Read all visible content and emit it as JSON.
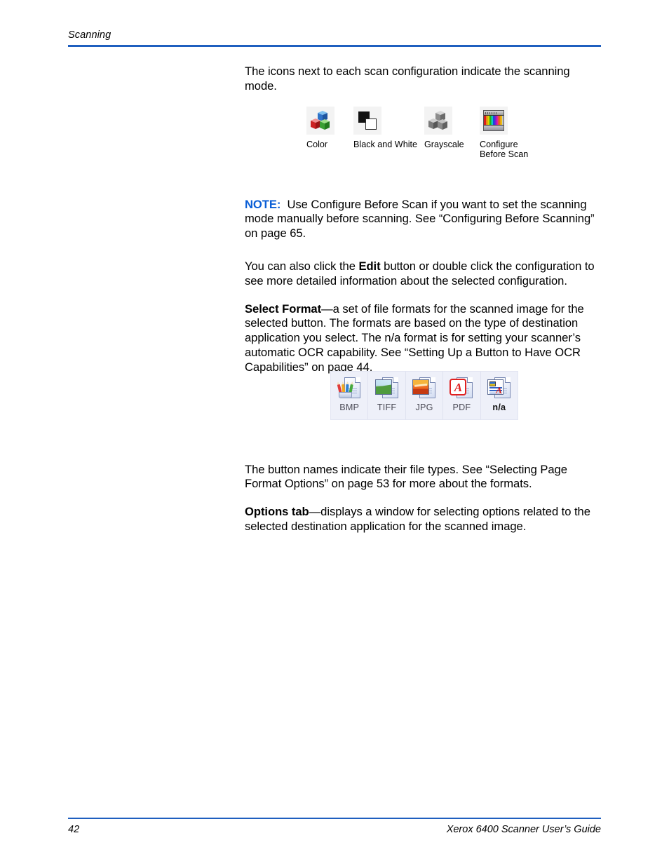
{
  "header": {
    "title": "Scanning"
  },
  "intro": {
    "text": "The icons next to each scan configuration indicate the scanning mode."
  },
  "scan_modes": [
    {
      "icon": "color-cubes-icon",
      "label": "Color"
    },
    {
      "icon": "black-and-white-squares-icon",
      "label": "Black and White"
    },
    {
      "icon": "grayscale-cubes-icon",
      "label": "Grayscale"
    },
    {
      "icon": "configure-before-scan-icon",
      "label": "Configure\nBefore Scan"
    }
  ],
  "note": {
    "label": "NOTE:",
    "text": "Use Configure Before Scan if you want to set the scanning mode manually before scanning. See “Configuring Before Scanning” on page 65.",
    "color": "#0B5FD6"
  },
  "edit_para": {
    "before": "You can also click the ",
    "bold": "Edit",
    "after": " button or double click the configuration to see more detailed information about the selected configuration."
  },
  "select_format_para": {
    "bold": "Select Format",
    "text": "—a set of file formats for the scanned image for the selected button. The formats are based on the type of destination application you select. The n/a format is for setting your scanner’s automatic OCR capability. See “Setting Up a Button to Have OCR Capabilities” on page 44."
  },
  "format_buttons": [
    {
      "label": "BMP",
      "icon": "bmp-document-pencils-icon",
      "selected": false
    },
    {
      "label": "TIFF",
      "icon": "tiff-document-photo-icon",
      "selected": false
    },
    {
      "label": "JPG",
      "icon": "jpg-document-photo-icon",
      "selected": false
    },
    {
      "label": "PDF",
      "icon": "pdf-document-acrobat-icon",
      "selected": false
    },
    {
      "label": "n/a",
      "icon": "na-document-ocr-icon",
      "selected": true
    }
  ],
  "format_names_para": {
    "text": "The button names indicate their file types. See “Selecting Page Format Options” on page 53 for more about the formats."
  },
  "options_tab_para": {
    "bold": "Options tab",
    "text": "—displays a window for selecting options related to the selected destination application for the scanned image."
  },
  "footer": {
    "page_number": "42",
    "guide_title": "Xerox 6400 Scanner User’s Guide",
    "rule_color": "#1F5FBF"
  }
}
